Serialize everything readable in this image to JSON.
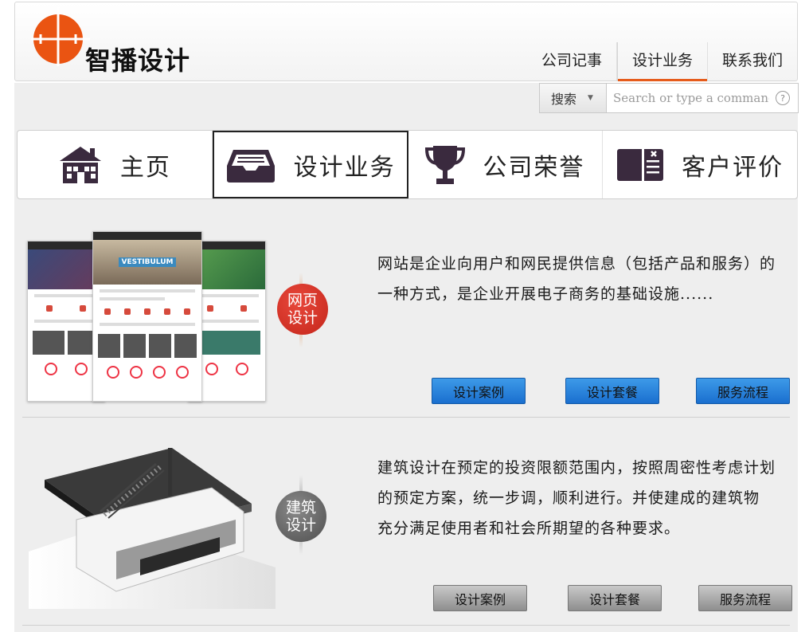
{
  "brand": {
    "name": "智播设计",
    "accent": "#e55b1b"
  },
  "topnav": {
    "items": [
      "公司记事",
      "设计业务",
      "联系我们"
    ],
    "active_index": 1
  },
  "search": {
    "scope_label": "搜索",
    "placeholder": "Search or type a command",
    "help_label": "?"
  },
  "tabs": [
    {
      "label": "主页",
      "icon": "house-icon"
    },
    {
      "label": "设计业务",
      "icon": "inbox-tray-icon",
      "active": true
    },
    {
      "label": "公司荣誉",
      "icon": "trophy-icon"
    },
    {
      "label": "客户评价",
      "icon": "comment-card-icon"
    }
  ],
  "sections": [
    {
      "badge": "网页设计",
      "badge_lines": [
        "网页",
        "设计"
      ],
      "badge_color": "#d0301f",
      "description_lines": [
        "网站是企业向用户和网民提供信息（包括产品和服务）的",
        "一种方式，是企业开展电子商务的基础设施......"
      ],
      "buttons": [
        "设计案例",
        "设计套餐",
        "服务流程"
      ],
      "mockup_text": "VESTIBULUM"
    },
    {
      "badge": "建筑设计",
      "badge_lines": [
        "建筑",
        "设计"
      ],
      "badge_color": "#5a5a5a",
      "description_lines": [
        "建筑设计在预定的投资限额范围内，按照周密性考虑计划",
        "的预定方案，统一步调，顺利进行。并使建成的建筑物",
        "充分满足使用者和社会所期望的各种要求。"
      ],
      "buttons": [
        "设计案例",
        "设计套餐",
        "服务流程"
      ]
    }
  ]
}
